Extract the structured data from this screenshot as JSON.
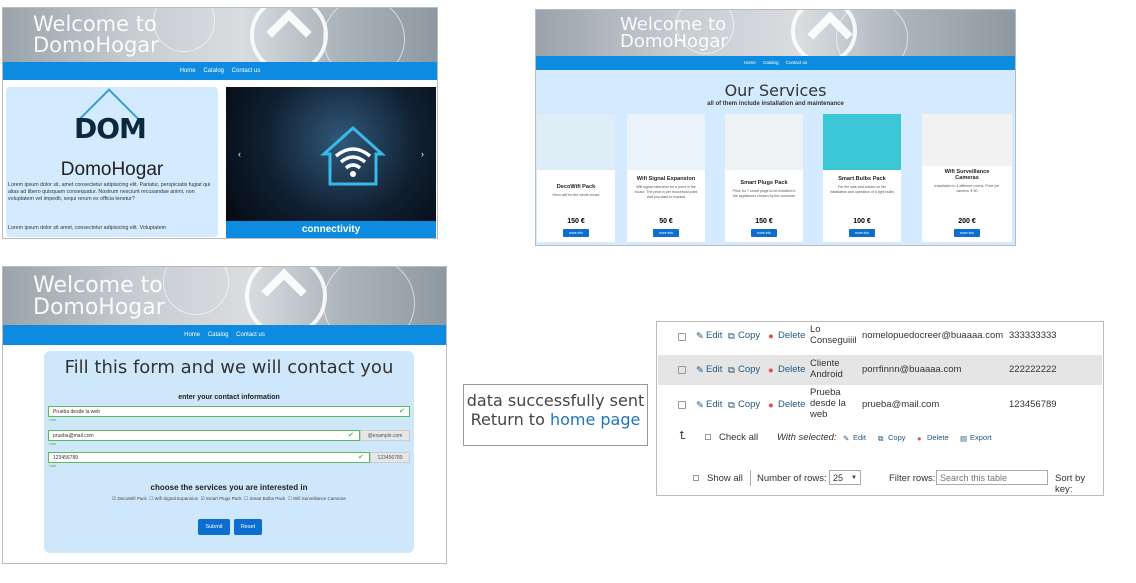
{
  "banner": {
    "title_line1": "Welcome to",
    "title_line2": "DomoHogar"
  },
  "nav": {
    "home": "Home",
    "catalog": "Catalog",
    "contact": "Contact us"
  },
  "home": {
    "logo_text": "DOM",
    "brand": "DomoHogar",
    "lorem1": "Lorem ipsum dolor sit, amet consectetur adipisicing elit. Pariatur, perspiciatis fugiat qui alias ad libero quisquam consequatur. Nostrum nesciunt recusandae animi, non voluptatem vel impedit, sequi rerum ex officia tenetur?",
    "lorem2": "Lorem ipsum dolor sit amet, consectetur adipisicing elit. Voluptatem",
    "carousel_caption": "connectivity",
    "prev": "‹",
    "next": "›"
  },
  "services": {
    "title": "Our Services",
    "subtitle": "all of them include installation and maintenance",
    "cards": [
      {
        "name": "DecoWifi Pack",
        "desc": "Deco wifi for the whole house",
        "price": "150 €",
        "button": "more info",
        "color": "#dfeef6"
      },
      {
        "name": "Wifi Signal Expansion",
        "desc": "Wifi signal extension for a point in the house. The price is per household point that you want to expand",
        "price": "50 €",
        "button": "more info",
        "color": "#eaf3fb"
      },
      {
        "name": "Smart Plugs Pack",
        "desc": "Price for 7 smart plugs to be installed in the appliances chosen by the customer",
        "price": "150 €",
        "button": "more info",
        "color": "#eef2f4"
      },
      {
        "name": "Smart Bulbs Pack",
        "desc": "For the sale and advice on the installation and operation of 6 light bulbs",
        "price": "100 €",
        "button": "more info",
        "color": "#3cc7d6"
      },
      {
        "name": "Wifi Surveillance Cameras",
        "desc": "Installation in 4 different rooms. Price per camera: € 50",
        "price": "200 €",
        "button": "more info",
        "color": "#f2f2f2"
      }
    ]
  },
  "form": {
    "title": "Fill this form and we will contact you",
    "subtitle": "enter your contact information",
    "name_value": "Prueba desde la web",
    "email_value": "prueba@mail.com",
    "email_addon": "@example.com",
    "phone_value": "123456789",
    "phone_addon": "123456789",
    "valid_label": "valid",
    "services_title": "choose the services you are interested in",
    "services": [
      "DecoWifi Pack",
      "Wifi Signal Expansion",
      "Smart Plugs Pack",
      "Smart Bulbs Pack",
      "Wifi Surveillance Cameras"
    ],
    "services_checked": [
      true,
      false,
      true,
      false,
      false
    ],
    "submit": "Submit",
    "reset": "Reset"
  },
  "success": {
    "line1": "data successfully sent",
    "line2_prefix": "Return to ",
    "link": "home page"
  },
  "table": {
    "rows": [
      {
        "edit": "Edit",
        "copy": "Copy",
        "delete": "Delete",
        "name": "Lo Conseguiiil",
        "email": "nomelopuedocreer@buaaaa.com",
        "phone": "333333333"
      },
      {
        "edit": "Edit",
        "copy": "Copy",
        "delete": "Delete",
        "name": "Cliente Android",
        "email": "porrfinnn@buaaaa.com",
        "phone": "222222222"
      },
      {
        "edit": "Edit",
        "copy": "Copy",
        "delete": "Delete",
        "name": "Prueba desde la web",
        "email": "prueba@mail.com",
        "phone": "123456789"
      }
    ],
    "check_all": "Check all",
    "with_selected": "With selected:",
    "bulk_edit": "Edit",
    "bulk_copy": "Copy",
    "bulk_delete": "Delete",
    "bulk_export": "Export",
    "show_all": "Show all",
    "rows_label": "Number of rows:",
    "rows_value": "25",
    "filter_label": "Filter rows:",
    "filter_placeholder": "Search this table",
    "sort_label": "Sort by key:"
  },
  "colors": {
    "nav": "#0d8be0",
    "panel_bg": "#d4ebff",
    "button": "#0d6ecf",
    "valid": "#5cb85c",
    "link": "#1e73be"
  }
}
